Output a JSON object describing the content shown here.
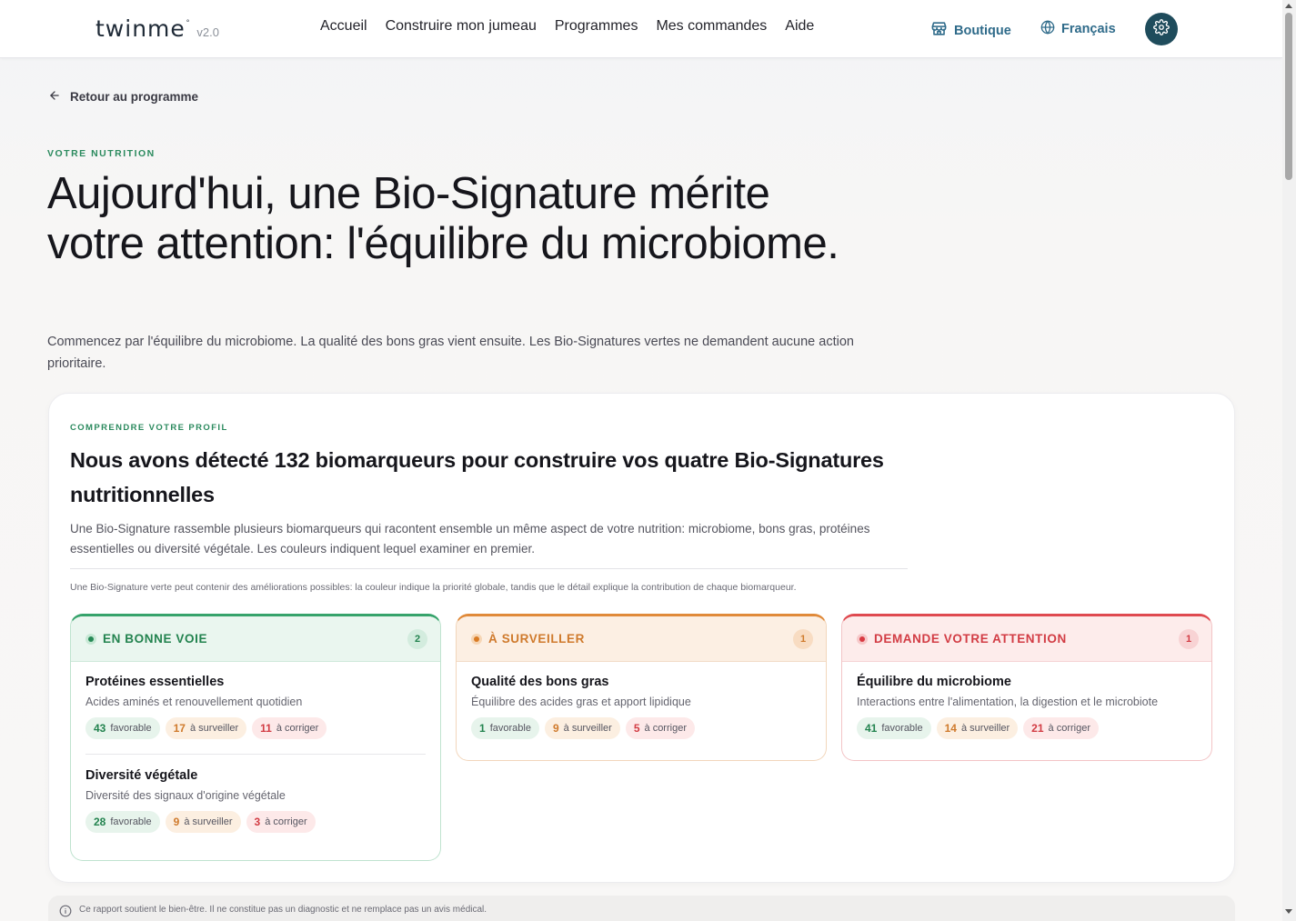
{
  "header": {
    "logo_text": "twinme",
    "logo_mark": "°",
    "version": "v2.0",
    "nav": [
      "Accueil",
      "Construire mon jumeau",
      "Programmes",
      "Mes commandes",
      "Aide"
    ],
    "shop_label": "Boutique",
    "language_label": "Français",
    "accent_color": "#2f6b8a"
  },
  "back_link": "Retour au programme",
  "hero": {
    "eyebrow": "VOTRE NUTRITION",
    "title": "Aujourd'hui, une Bio-Signature mérite votre attention: l'équilibre du microbiome.",
    "subtitle": "Commencez par l'équilibre du microbiome. La qualité des bons gras vient ensuite. Les Bio-Signatures vertes ne demandent aucune action prioritaire."
  },
  "profile": {
    "eyebrow": "COMPRENDRE VOTRE PROFIL",
    "title": "Nous avons détecté 132 biomarqueurs pour construire vos quatre Bio-Signatures nutritionnelles",
    "description": "Une Bio-Signature rassemble plusieurs biomarqueurs qui racontent ensemble un même aspect de votre nutrition: microbiome, bons gras, protéines essentielles ou diversité végétale. Les couleurs indiquent lequel examiner en premier.",
    "note": "Une Bio-Signature verte peut contenir des améliorations possibles: la couleur indique la priorité globale, tandis que le détail explique la contribution de chaque biomarqueur.",
    "columns": [
      {
        "label": "EN BONNE VOIE",
        "count": "2",
        "color": "#36a36b",
        "items": [
          {
            "name": "Protéines essentielles",
            "desc": "Acides aminés et renouvellement quotidien",
            "favorable": "43",
            "surveiller": "17",
            "corriger": "11"
          },
          {
            "name": "Diversité végétale",
            "desc": "Diversité des signaux d'origine végétale",
            "favorable": "28",
            "surveiller": "9",
            "corriger": "3"
          }
        ]
      },
      {
        "label": "À SURVEILLER",
        "count": "1",
        "color": "#e08a3a",
        "items": [
          {
            "name": "Qualité des bons gras",
            "desc": "Équilibre des acides gras et apport lipidique",
            "favorable": "1",
            "surveiller": "9",
            "corriger": "5"
          }
        ]
      },
      {
        "label": "DEMANDE VOTRE ATTENTION",
        "count": "1",
        "color": "#df4a50",
        "items": [
          {
            "name": "Équilibre du microbiome",
            "desc": "Interactions entre l'alimentation, la digestion et le microbiote",
            "favorable": "41",
            "surveiller": "14",
            "corriger": "21"
          }
        ]
      }
    ],
    "chip_labels": {
      "favorable": "favorable",
      "surveiller": "à surveiller",
      "corriger": "à corriger"
    }
  },
  "disclaimer": "Ce rapport soutient le bien-être. Il ne constitue pas un diagnostic et ne remplace pas un avis médical."
}
